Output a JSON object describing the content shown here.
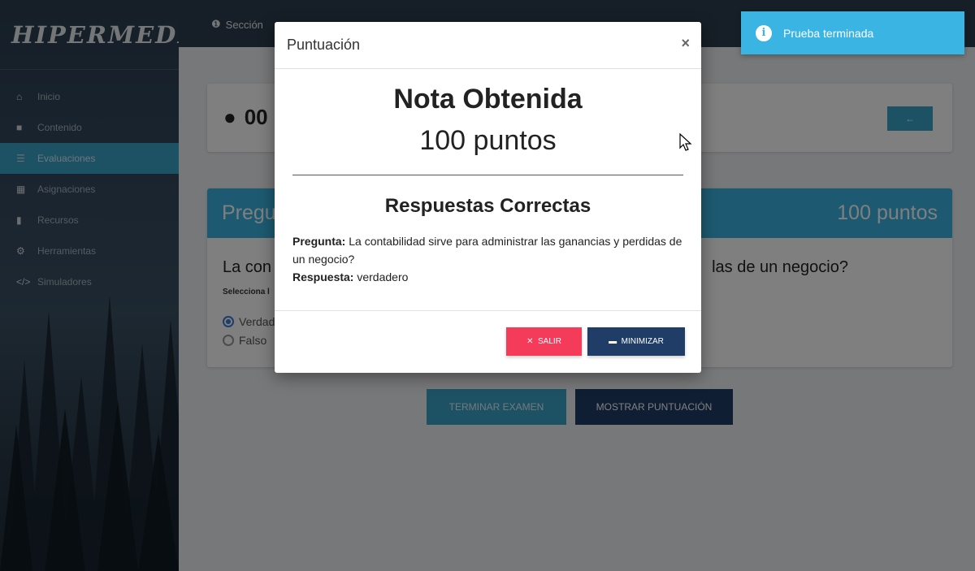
{
  "app": {
    "logo": "HIPERMEDIA"
  },
  "sidebar": {
    "items": [
      {
        "label": "Inicio",
        "icon": "home-icon",
        "glyph": "⌂"
      },
      {
        "label": "Contenido",
        "icon": "book-icon",
        "glyph": "■"
      },
      {
        "label": "Evaluaciones",
        "icon": "list-icon",
        "glyph": "☰",
        "active": true
      },
      {
        "label": "Asignaciones",
        "icon": "calendar-icon",
        "glyph": "▦"
      },
      {
        "label": "Recursos",
        "icon": "file-icon",
        "glyph": "▮"
      },
      {
        "label": "Herramientas",
        "icon": "tools-icon",
        "glyph": "⚙"
      },
      {
        "label": "Simuladores",
        "icon": "code-icon",
        "glyph": "</>"
      }
    ]
  },
  "topbar": {
    "section_label": "Sección",
    "info_icon": "info-icon"
  },
  "timer": {
    "text": "00"
  },
  "question_panel": {
    "header_left": "Pregu",
    "header_right": "100 puntos",
    "question_left": "La con",
    "question_right": "las de un negocio?",
    "select_label": "Selecciona l",
    "options": [
      "Verdad",
      "Falso"
    ]
  },
  "actions": {
    "terminar": "TERMINAR EXAMEN",
    "mostrar": "MOSTRAR PUNTUACIÓN"
  },
  "modal": {
    "title": "Puntuación",
    "close": "×",
    "nota_title": "Nota Obtenida",
    "nota_value": "100 puntos",
    "respuestas_title": "Respuestas Correctas",
    "pregunta_label": "Pregunta:",
    "pregunta_text": "La contabilidad sirve para administrar las ganancias y perdidas de un negocio?",
    "respuesta_label": "Respuesta:",
    "respuesta_text": "verdadero",
    "salir": "SALIR",
    "minimizar": "MINIMIZAR"
  },
  "toast": {
    "text": "Prueba terminada",
    "icon": "info-icon"
  },
  "colors": {
    "accent": "#3ab4e2",
    "danger": "#f43b5a",
    "navy": "#1f3d66"
  }
}
